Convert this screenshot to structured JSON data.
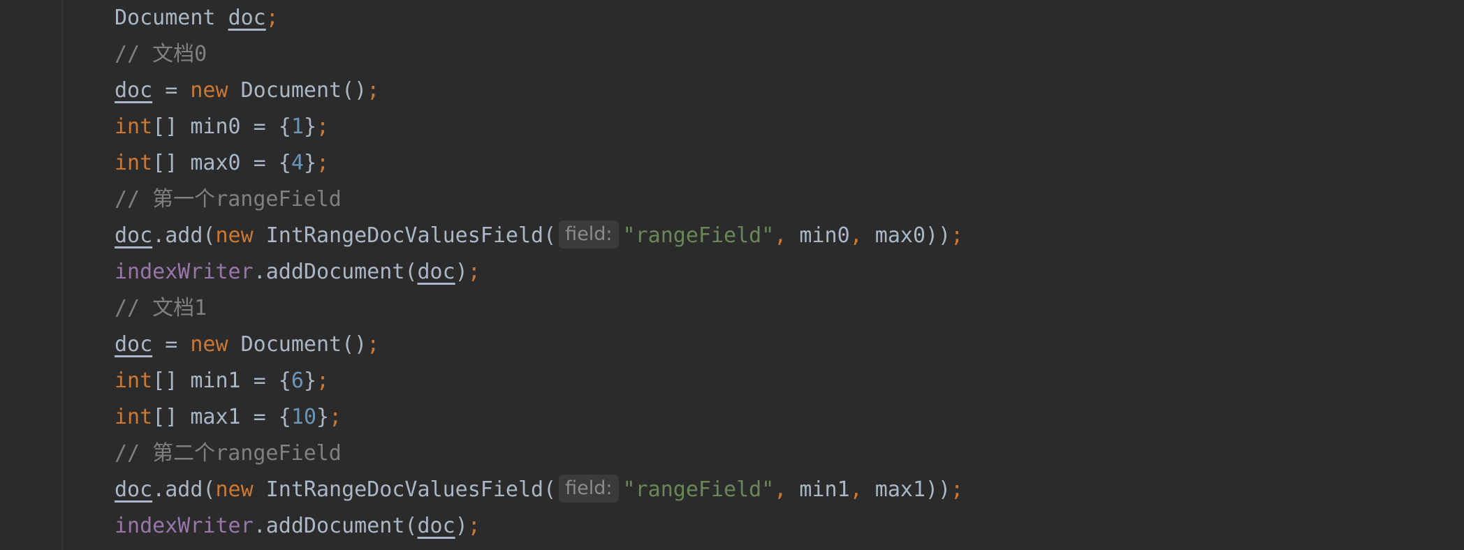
{
  "editor": {
    "lines": [
      [
        "Document",
        "doc",
        ";"
      ],
      [
        "// 文档0"
      ],
      [
        "doc",
        " = ",
        "new",
        " Document()",
        ";"
      ],
      [
        "int",
        "[] min0 = {",
        "1",
        "}",
        ";"
      ],
      [
        "int",
        "[] max0 = {",
        "4",
        "}",
        ";"
      ],
      [
        "// 第一个rangeField"
      ],
      [
        "doc",
        ".add(",
        "new",
        " IntRangeDocValuesField(",
        "field:",
        "\"rangeField\"",
        ",",
        " min0",
        ",",
        " max0))",
        ";"
      ],
      [
        "indexWriter",
        ".addDocument(",
        "doc",
        ")",
        ";"
      ],
      [
        "// 文档1"
      ],
      [
        "doc",
        " = ",
        "new",
        " Document()",
        ";"
      ],
      [
        "int",
        "[] min1 = {",
        "6",
        "}",
        ";"
      ],
      [
        "int",
        "[] max1 = {",
        "10",
        "}",
        ";"
      ],
      [
        "// 第二个rangeField"
      ],
      [
        "doc",
        ".add(",
        "new",
        " IntRangeDocValuesField(",
        "field:",
        "\"rangeField\"",
        ",",
        " min1",
        ",",
        " max1))",
        ";"
      ],
      [
        "indexWriter",
        ".addDocument(",
        "doc",
        ")",
        ";"
      ]
    ]
  },
  "colors": {
    "background": "#2b2b2b",
    "text": "#a9b7c6",
    "keyword": "#cc7832",
    "number": "#6897bb",
    "string": "#6a8759",
    "comment": "#808080",
    "field": "#9876aa",
    "hint_bg": "#3b3b3b",
    "hint_text": "#8c8c8c"
  }
}
